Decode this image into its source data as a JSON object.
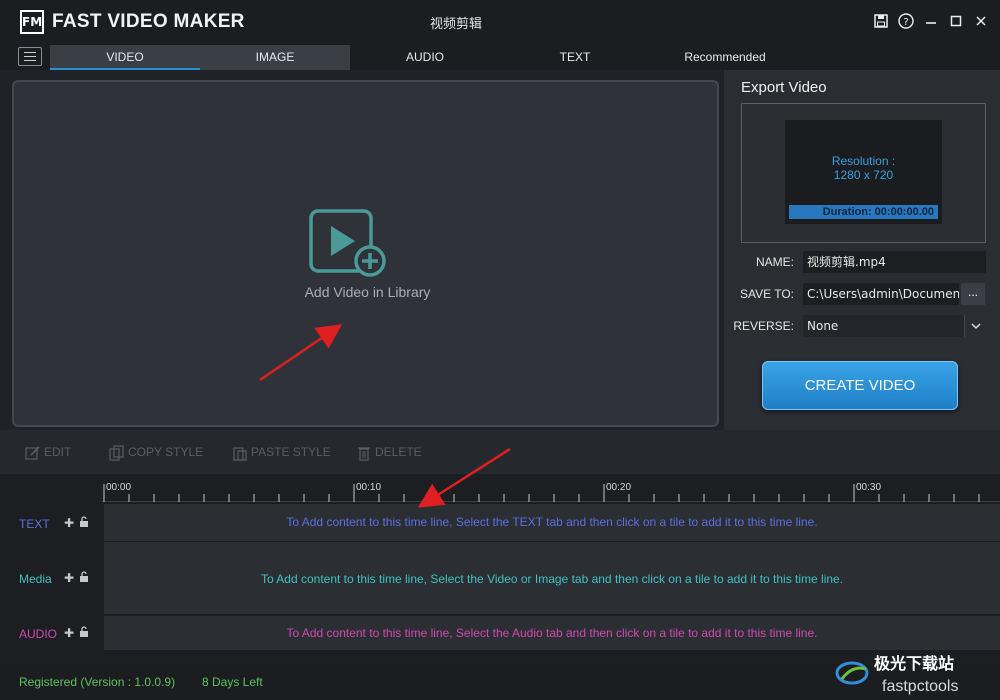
{
  "app": {
    "logo": "FM",
    "name": "FAST VIDEO MAKER",
    "document_title": "视频剪辑"
  },
  "window_controls": [
    {
      "name": "save-icon",
      "glyph": "💾"
    },
    {
      "name": "help-icon",
      "glyph": "?"
    },
    {
      "name": "minimize-icon",
      "glyph": "—"
    },
    {
      "name": "maximize-icon",
      "glyph": "☐"
    },
    {
      "name": "close-icon",
      "glyph": "X"
    }
  ],
  "tabs": [
    {
      "label": "VIDEO",
      "active": true
    },
    {
      "label": "IMAGE",
      "active": false
    },
    {
      "label": "AUDIO",
      "active": false
    },
    {
      "label": "TEXT",
      "active": false
    },
    {
      "label": "Recommended",
      "active": false
    }
  ],
  "preview": {
    "add_label": "Add Video in Library",
    "icon": "video-add-icon"
  },
  "export": {
    "title": "Export Video",
    "resolution_label": "Resolution :",
    "resolution_value": "1280 x 720",
    "duration": "Duration: 00:00:00.00",
    "name_label": "NAME:",
    "name_value": "视频剪辑.mp4",
    "save_label": "SAVE TO:",
    "save_value": "C:\\Users\\admin\\Documents",
    "browse": "...",
    "reverse_label": "REVERSE:",
    "reverse_value": "None",
    "create_button": "CREATE VIDEO"
  },
  "toolbar": {
    "edit": "EDIT",
    "copy_style": "COPY STYLE",
    "paste_style": "PASTE STYLE",
    "delete": "DELETE"
  },
  "timeline": {
    "ticks": [
      "00:00",
      "00:10",
      "00:20",
      "00:30"
    ],
    "tracks": [
      {
        "label": "TEXT",
        "color": "#5a70e0",
        "hint": "To Add content to this time line, Select the TEXT tab and then click on a tile to add it to this time line."
      },
      {
        "label": "Media",
        "color": "#3fc2c2",
        "hint": "To Add content to this time line, Select the Video or Image tab and then click on a tile to add it to this time line."
      },
      {
        "label": "AUDIO",
        "color": "#d04ab0",
        "hint": "To Add content to this time line, Select the Audio tab and then click on a tile to add it to this time line."
      }
    ]
  },
  "status": {
    "registered": "Registered (Version : 1.0.0.9)",
    "days_left": "8 Days Left"
  },
  "watermark": {
    "line1": "极光下载站",
    "line2": "fastpctools"
  },
  "colors": {
    "accent": "#2f8fd8",
    "status_green": "#5ec35e",
    "annotation_red": "#e02020"
  }
}
